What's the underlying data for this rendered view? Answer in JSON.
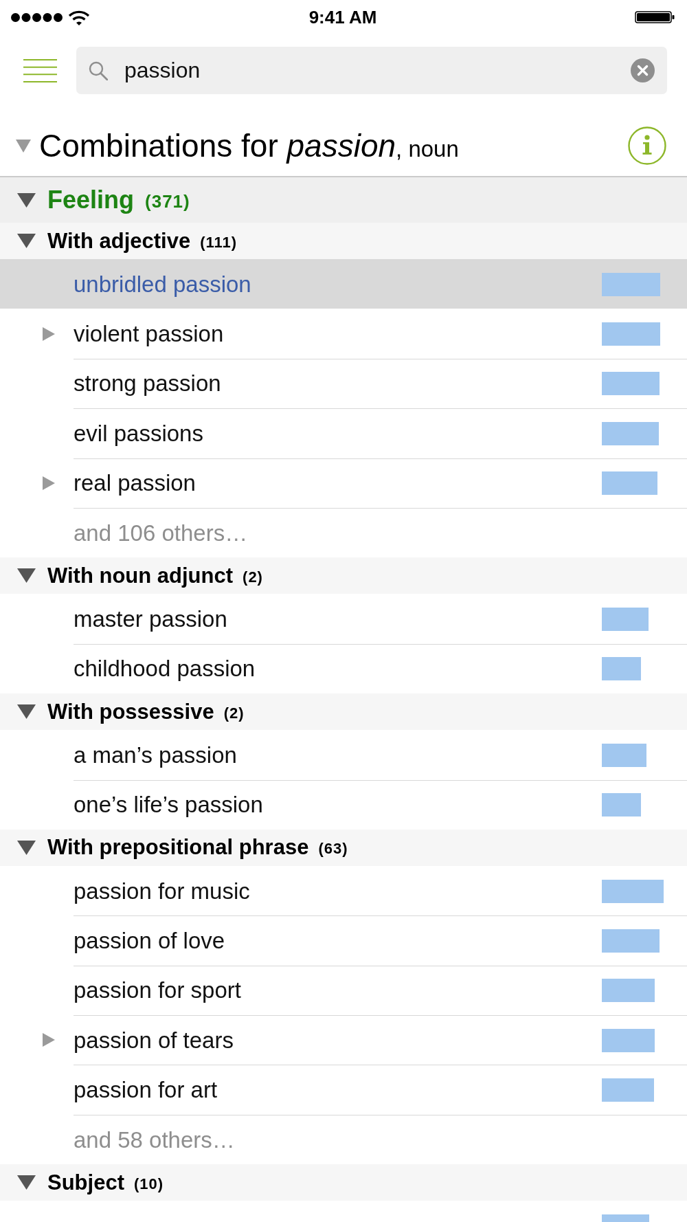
{
  "status_bar": {
    "time": "9:41 AM"
  },
  "search": {
    "value": "passion"
  },
  "heading": {
    "title": "Combinations for *passion*",
    "part_of_speech": ", noun",
    "expanded": true
  },
  "categories": [
    {
      "label": "Feeling",
      "count": "(371)",
      "expanded": true,
      "groups": [
        {
          "label": "With adjective",
          "count": "(111)",
          "expanded": true,
          "entries": [
            {
              "text": "unbridled passion",
              "selected": true,
              "has_subentries": false
            },
            {
              "text": "violent passion",
              "selected": false,
              "has_subentries": true
            },
            {
              "text": "strong passion",
              "selected": false,
              "has_subentries": false
            },
            {
              "text": "evil passions",
              "selected": false,
              "has_subentries": false
            },
            {
              "text": "real passion",
              "selected": false,
              "has_subentries": true
            }
          ],
          "more": "and 106 others…"
        },
        {
          "label": "With noun adjunct",
          "count": "(2)",
          "expanded": true,
          "entries": [
            {
              "text": "master passion",
              "selected": false,
              "has_subentries": false
            },
            {
              "text": "childhood passion",
              "selected": false,
              "has_subentries": false
            }
          ]
        },
        {
          "label": "With possessive",
          "count": "(2)",
          "expanded": true,
          "entries": [
            {
              "text": "a man’s passion",
              "selected": false,
              "has_subentries": false
            },
            {
              "text": "one’s life’s passion",
              "selected": false,
              "has_subentries": false
            }
          ]
        },
        {
          "label": "With prepositional phrase",
          "count": "(63)",
          "expanded": true,
          "entries": [
            {
              "text": "passion for music",
              "selected": false,
              "has_subentries": false
            },
            {
              "text": "passion of love",
              "selected": false,
              "has_subentries": false
            },
            {
              "text": "passion for sport",
              "selected": false,
              "has_subentries": false
            },
            {
              "text": "passion of tears",
              "selected": false,
              "has_subentries": true
            },
            {
              "text": "passion for art",
              "selected": false,
              "has_subentries": false
            }
          ],
          "more": "and 58 others…"
        },
        {
          "label": "Subject",
          "count": "(10)",
          "expanded": true,
          "entries": [
            {
              "selected": false,
              "has_subentries": false
            }
          ]
        }
      ]
    }
  ]
}
